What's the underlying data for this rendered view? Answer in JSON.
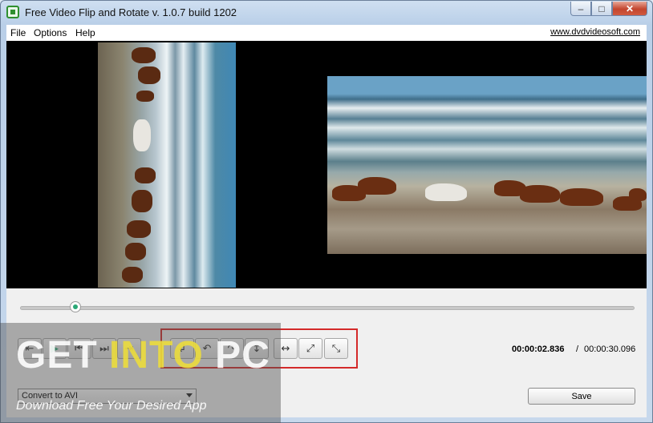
{
  "window": {
    "title": "Free Video Flip and Rotate v. 1.0.7 build 1202"
  },
  "menubar": {
    "items": [
      "File",
      "Options",
      "Help"
    ],
    "website": "www.dvdvideosoft.com"
  },
  "player": {
    "seek_position": 0.09,
    "icons": {
      "prev": "⇤",
      "play": "▶",
      "step_back": "⏮",
      "step_fwd": "⏭",
      "next": "⇥"
    }
  },
  "transform": {
    "icons": [
      "↲",
      "↶",
      "↷",
      "↕",
      "↔",
      "⤢",
      "⤡"
    ]
  },
  "time": {
    "current": "00:00:02.836",
    "separator": "/",
    "total": "00:00:30.096"
  },
  "format": {
    "selected": "Convert to AVI"
  },
  "save_label": "Save",
  "watermark": {
    "part1": "GET ",
    "part2": "INTO",
    "part3": " PC",
    "sub": "Download Free Your Desired App"
  },
  "colors": {
    "accent": "#2aa876",
    "highlight": "#d42a2a"
  }
}
